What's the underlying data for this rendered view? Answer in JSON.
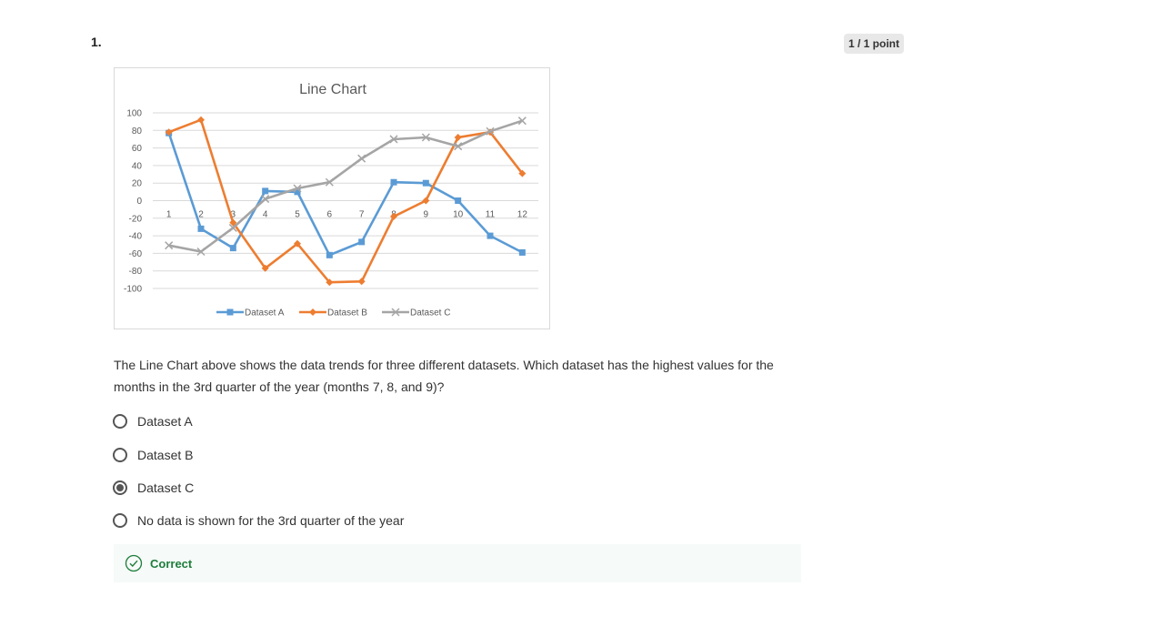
{
  "question": {
    "number": "1.",
    "score": "1 / 1 point",
    "text": "The Line Chart above shows the data trends for three different datasets.  Which dataset has the highest values for the months in the 3rd quarter of the year (months 7, 8, and 9)?",
    "options": [
      {
        "label": "Dataset A",
        "selected": false
      },
      {
        "label": "Dataset B",
        "selected": false
      },
      {
        "label": "Dataset C",
        "selected": true
      },
      {
        "label": "No data is shown for the 3rd quarter of the year",
        "selected": false
      }
    ],
    "feedback": {
      "label": "Correct",
      "icon": "check-circle-icon",
      "color": "#1e7d3c"
    }
  },
  "chart_data": {
    "type": "line",
    "title": "Line Chart",
    "xlabel": "",
    "ylabel": "",
    "x": [
      1,
      2,
      3,
      4,
      5,
      6,
      7,
      8,
      9,
      10,
      11,
      12
    ],
    "ylim": [
      -100,
      100
    ],
    "yticks": [
      100,
      80,
      60,
      40,
      20,
      0,
      -20,
      -40,
      -60,
      -80,
      -100
    ],
    "grid": true,
    "legend": "bottom",
    "series": [
      {
        "name": "Dataset A",
        "color": "#5b9bd5",
        "marker": "square",
        "values": [
          77,
          -32,
          -54,
          11,
          10,
          -62,
          -47,
          21,
          20,
          0,
          -40,
          -59
        ]
      },
      {
        "name": "Dataset B",
        "color": "#ed7d31",
        "marker": "diamond",
        "values": [
          78,
          92,
          -25,
          -77,
          -49,
          -93,
          -92,
          -18,
          0,
          72,
          78,
          31
        ]
      },
      {
        "name": "Dataset C",
        "color": "#a5a5a5",
        "marker": "x",
        "values": [
          -51,
          -58,
          -31,
          2,
          14,
          21,
          48,
          70,
          72,
          62,
          79,
          91
        ]
      }
    ]
  }
}
